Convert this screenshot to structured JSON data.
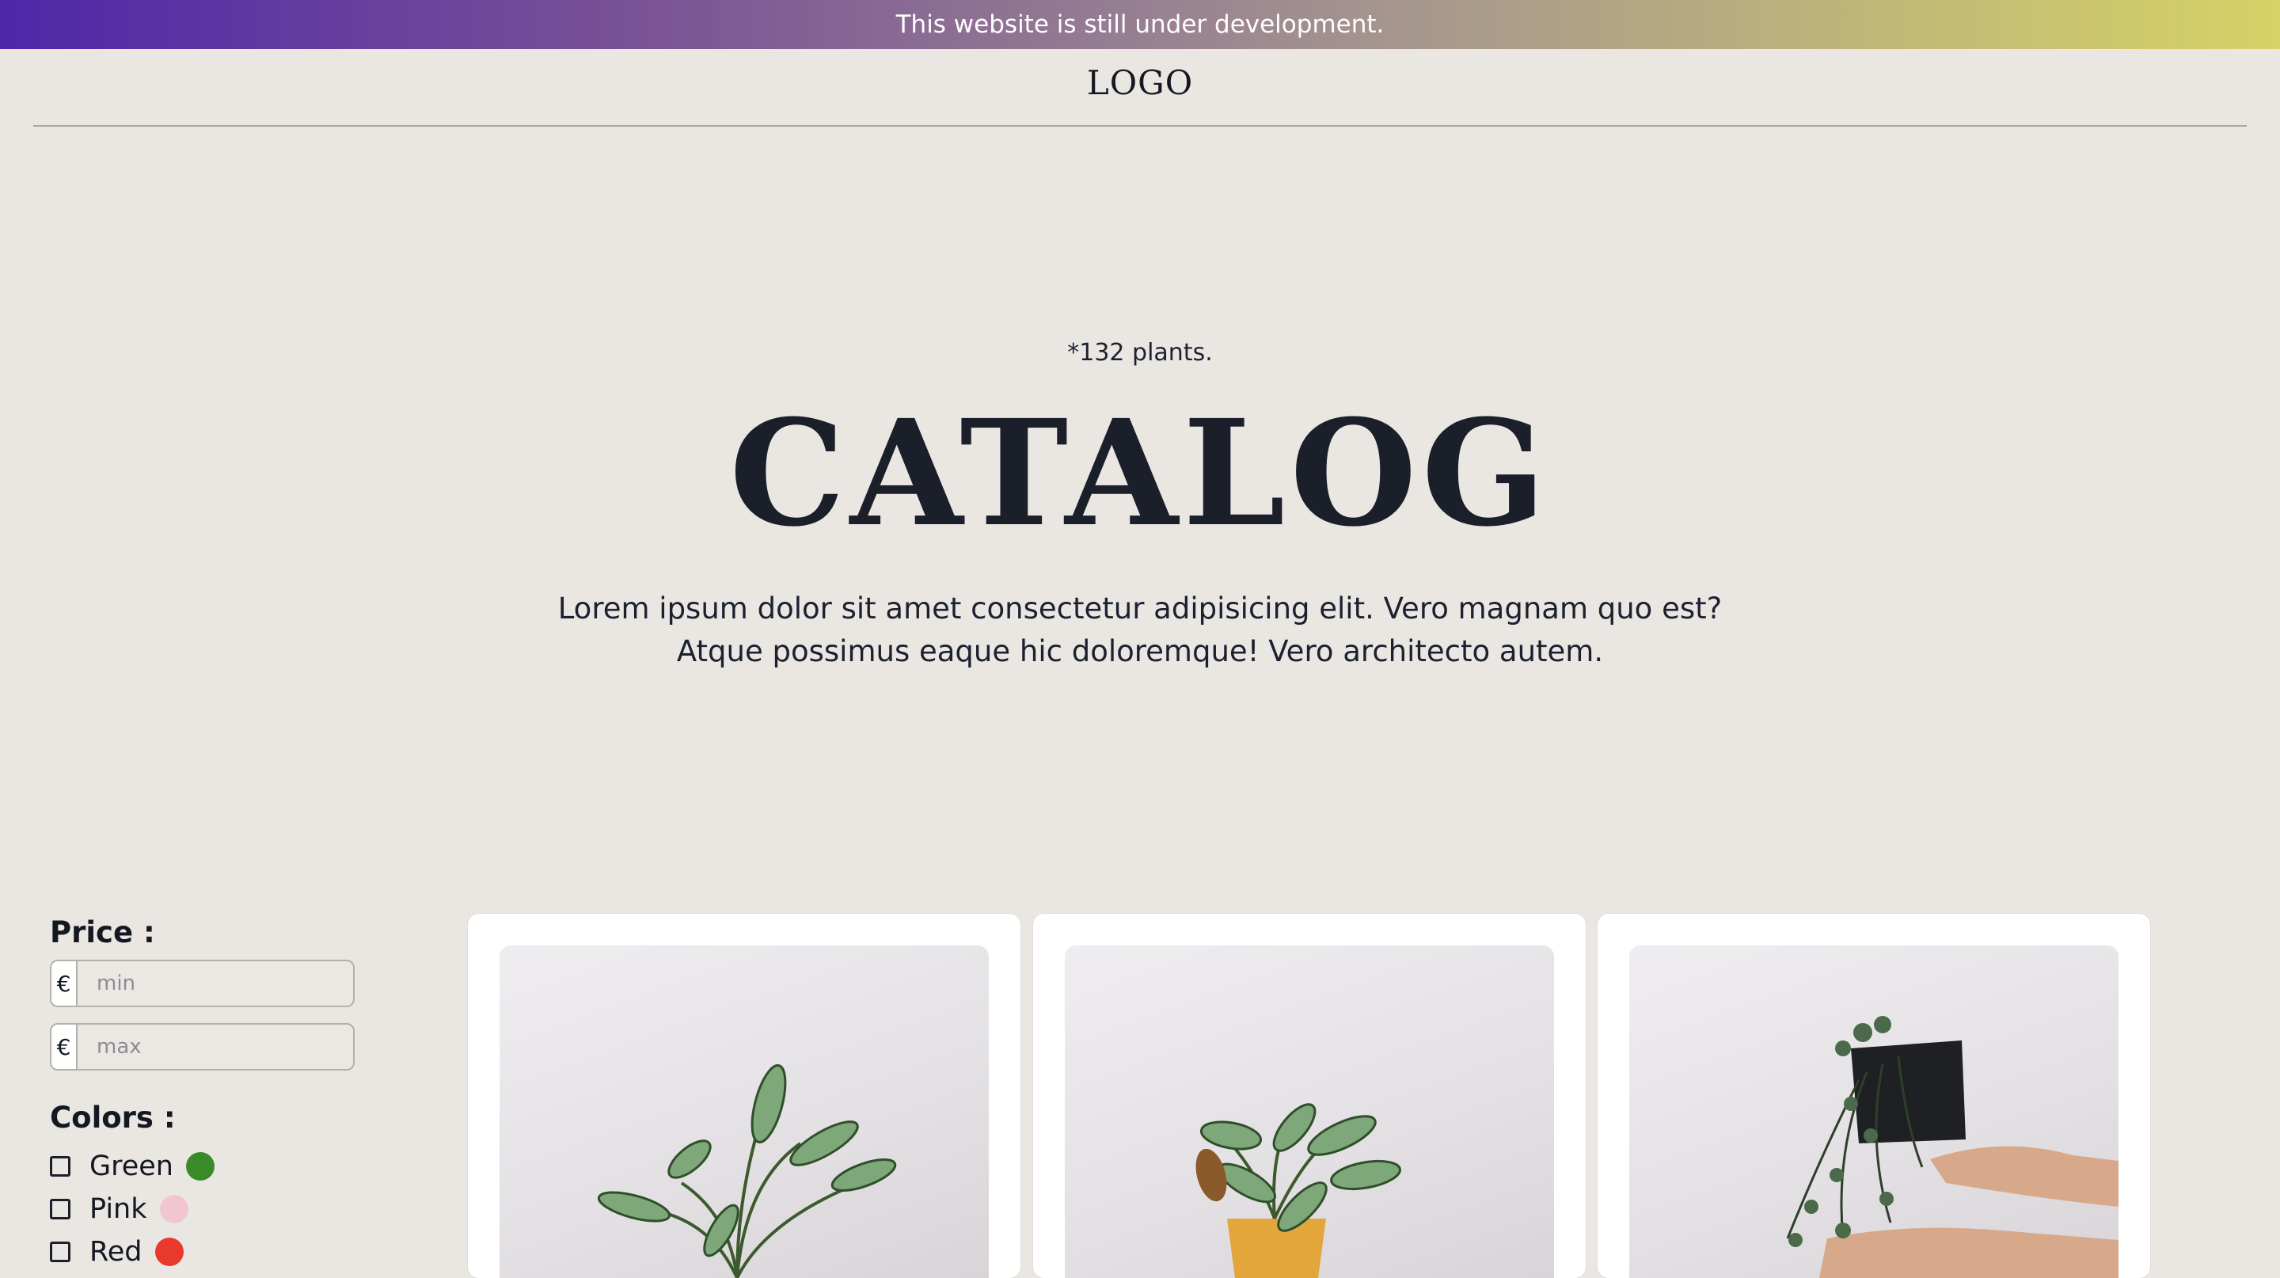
{
  "banner": {
    "text": "This website is still under development."
  },
  "header": {
    "logo": "LOGO"
  },
  "hero": {
    "count": "*132 plants.",
    "title": "CATALOG",
    "description_line1": "Lorem ipsum dolor sit amet consectetur adipisicing elit. Vero magnam quo est?",
    "description_line2": "Atque possimus eaque hic doloremque! Vero architecto autem."
  },
  "filters": {
    "price_label": "Price :",
    "currency_symbol": "€",
    "min_placeholder": "min",
    "max_placeholder": "max",
    "colors_label": "Colors :",
    "colors": [
      {
        "label": "Green",
        "swatch": "#3a8a2a"
      },
      {
        "label": "Pink",
        "swatch": "#f2c6d0"
      },
      {
        "label": "Red",
        "swatch": "#e8392c"
      }
    ]
  },
  "products": [
    {
      "image": "calathea-plant-photo"
    },
    {
      "image": "calathea-yellow-pot-photo"
    },
    {
      "image": "string-of-hearts-plant-photo"
    }
  ]
}
